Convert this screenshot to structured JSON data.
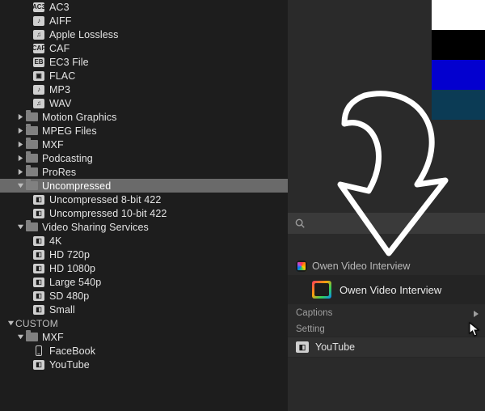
{
  "sidebar": {
    "audio_items": [
      {
        "icon": "AC3",
        "label": "AC3"
      },
      {
        "icon": "♪",
        "label": "AIFF"
      },
      {
        "icon": "♫",
        "label": "Apple Lossless"
      },
      {
        "icon": "CAF",
        "label": "CAF"
      },
      {
        "icon": "EB",
        "label": "EC3 File"
      },
      {
        "icon": "▣",
        "label": "FLAC"
      },
      {
        "icon": "♪",
        "label": "MP3"
      },
      {
        "icon": "♫",
        "label": "WAV"
      }
    ],
    "folders_collapsed": [
      {
        "label": "Motion Graphics"
      },
      {
        "label": "MPEG Files"
      },
      {
        "label": "MXF"
      },
      {
        "label": "Podcasting"
      },
      {
        "label": "ProRes"
      }
    ],
    "uncompressed": {
      "label": "Uncompressed",
      "children": [
        {
          "label": "Uncompressed 8-bit 422"
        },
        {
          "label": "Uncompressed 10-bit 422"
        }
      ]
    },
    "video_sharing": {
      "label": "Video Sharing Services",
      "children": [
        {
          "label": "4K"
        },
        {
          "label": "HD 720p"
        },
        {
          "label": "HD 1080p"
        },
        {
          "label": "Large 540p"
        },
        {
          "label": "SD 480p"
        },
        {
          "label": "Small"
        }
      ]
    },
    "custom": {
      "section": "CUSTOM",
      "mxf": {
        "label": "MXF"
      },
      "facebook": {
        "label": "FaceBook"
      },
      "youtube": {
        "label": "YouTube"
      }
    }
  },
  "right": {
    "search_placeholder": "",
    "detail_header": "Owen Video Interview",
    "project_name": "Owen Video Interview",
    "captions_label": "Captions",
    "setting_label": "Setting",
    "setting_value": "YouTube"
  }
}
